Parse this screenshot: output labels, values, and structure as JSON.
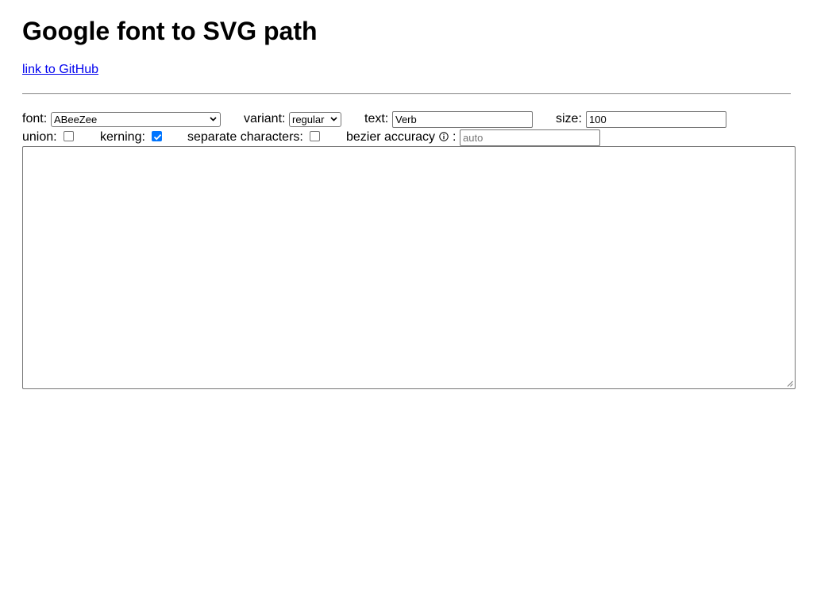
{
  "header": {
    "title": "Google font to SVG path",
    "github_link": "link to GitHub"
  },
  "controls_row1": {
    "font_label": "font:",
    "font_value": "ABeeZee",
    "variant_label": "variant:",
    "variant_value": "regular",
    "text_label": "text:",
    "text_value": "Verb",
    "size_label": "size:",
    "size_value": "100"
  },
  "controls_row2": {
    "union_label": "union:",
    "union_checked": false,
    "kerning_label": "kerning:",
    "kerning_checked": true,
    "separate_label": "separate characters:",
    "separate_checked": false,
    "bezier_label": "bezier accuracy",
    "bezier_colon": ":",
    "bezier_placeholder": "auto",
    "info_icon": "info-icon"
  },
  "output": {
    "value": ""
  },
  "colors": {
    "link": "#0000ee",
    "checkbox_accent": "#0075ff"
  }
}
